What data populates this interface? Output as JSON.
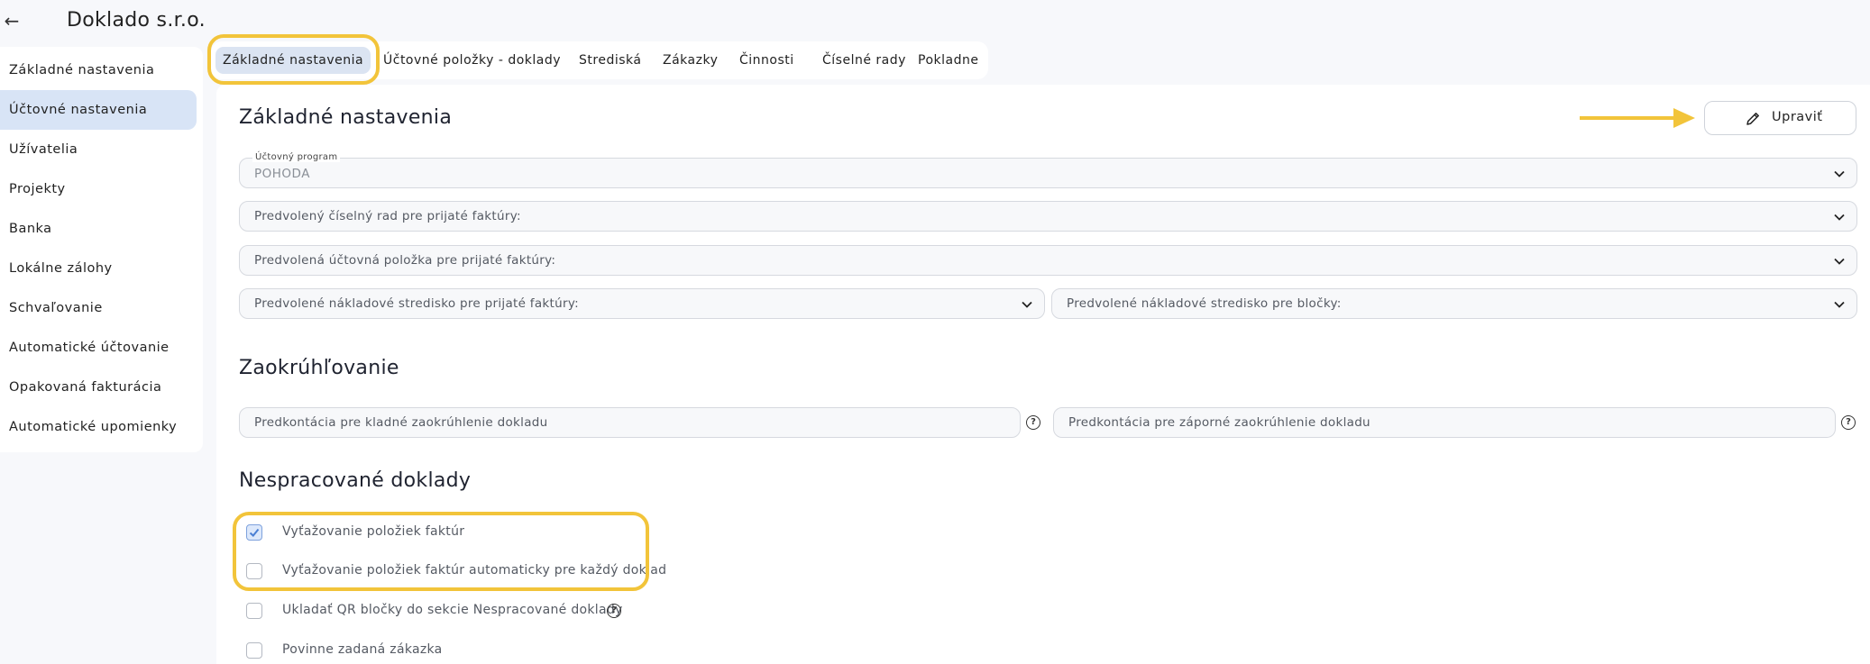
{
  "header": {
    "back_icon": "arrow-left-icon",
    "company_name": "Doklado s.r.o."
  },
  "sidebar": {
    "items": [
      {
        "label": "Základné nastavenia",
        "active": false
      },
      {
        "label": "Účtovné nastavenia",
        "active": true
      },
      {
        "label": "Užívatelia",
        "active": false
      },
      {
        "label": "Projekty",
        "active": false
      },
      {
        "label": "Banka",
        "active": false
      },
      {
        "label": "Lokálne zálohy",
        "active": false
      },
      {
        "label": "Schvaľovanie",
        "active": false
      },
      {
        "label": "Automatické účtovanie",
        "active": false
      },
      {
        "label": "Opakovaná fakturácia",
        "active": false
      },
      {
        "label": "Automatické upomienky",
        "active": false
      }
    ]
  },
  "tabs": [
    {
      "label": "Základné nastavenia",
      "active": true
    },
    {
      "label": "Účtovné položky - doklady",
      "active": false
    },
    {
      "label": "Strediská",
      "active": false
    },
    {
      "label": "Zákazky",
      "active": false
    },
    {
      "label": "Činnosti",
      "active": false
    },
    {
      "label": "Číselné rady",
      "active": false
    },
    {
      "label": "Pokladne",
      "active": false
    }
  ],
  "basic": {
    "title": "Základné nastavenia",
    "edit_label": "Upraviť",
    "accounting_program": {
      "label": "Účtovný program",
      "value": "POHODA"
    },
    "default_number_series": "Predvolený číselný rad pre prijaté faktúry:",
    "default_account_item": "Predvolená účtovná položka pre prijaté faktúry:",
    "default_cost_center_invoices": "Predvolené nákladové stredisko pre prijaté faktúry:",
    "default_cost_center_receipts": "Predvolené nákladové stredisko pre bločky:"
  },
  "rounding": {
    "title": "Zaokrúhľovanie",
    "positive": "Predkontácia pre kladné zaokrúhlenie dokladu",
    "negative": "Predkontácia pre záporné zaokrúhlenie dokladu"
  },
  "unprocessed": {
    "title": "Nespracované doklady",
    "options": [
      {
        "label": "Vyťažovanie položiek faktúr",
        "checked": true
      },
      {
        "label": "Vyťažovanie položiek faktúr automaticky pre každý doklad",
        "checked": false
      },
      {
        "label": "Ukladať QR bločky do sekcie Nespracované doklady",
        "checked": false
      },
      {
        "label": "Povinne zadaná zákazka",
        "checked": false
      }
    ]
  },
  "colors": {
    "highlight": "#f2c43a",
    "active_bg": "#d8e4f6"
  }
}
